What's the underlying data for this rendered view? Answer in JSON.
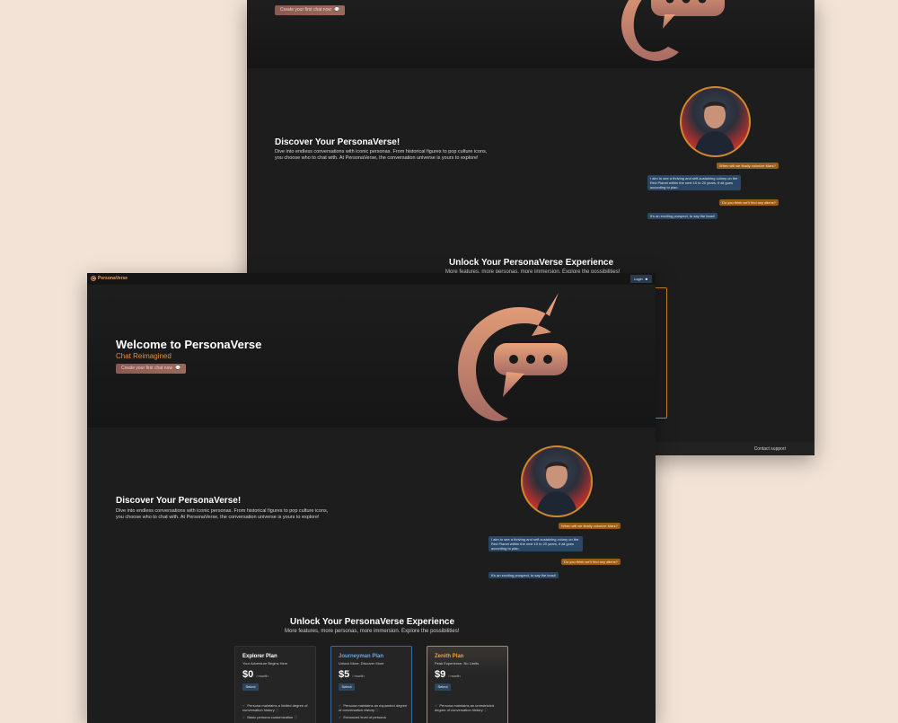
{
  "app": {
    "brand": "PersonaVerse",
    "login_label": "Login"
  },
  "hero": {
    "title": "Welcome to PersonaVerse",
    "tagline": "Chat Reimagined",
    "cta_label": "Create your first chat now"
  },
  "discover": {
    "title": "Discover Your PersonaVerse!",
    "body": "Dive into endless conversations with iconic personas. From historical figures to pop culture icons, you choose who to chat with. At PersonaVerse, the conversation universe is yours to explore!"
  },
  "chat": {
    "messages": [
      {
        "role": "user",
        "text": "When will we finally colonize Mars?"
      },
      {
        "role": "persona",
        "text": "I aim to see a thriving and self-sustaining colony on the Red Planet within the next 10 to 20 years, if all goes according to plan."
      },
      {
        "role": "user",
        "text": "Do you think we'll find any aliens?"
      },
      {
        "role": "persona",
        "text": "It's an exciting prospect, to say the least!"
      }
    ]
  },
  "plans": {
    "title": "Unlock Your PersonaVerse Experience",
    "subtitle": "More features, more personas, more immersion. Explore the possibilities!",
    "items": [
      {
        "name": "Explorer Plan",
        "tagline": "Your Adventure Begins Here",
        "price": "$0",
        "period": "/ month",
        "select_label": "Select",
        "features": [
          "Persona maintains a limited degree of conversation history",
          "Basic persona customization"
        ]
      },
      {
        "name": "Journeyman Plan",
        "tagline": "Unlock More, Discover More",
        "price": "$5",
        "period": "/ month",
        "select_label": "Select",
        "features": [
          "Persona maintains an expanded degree of conversation history",
          "Enhanced level of persona"
        ]
      },
      {
        "name": "Zenith Plan",
        "tagline": "Peak Experience, No Limits",
        "price": "$9",
        "period": "/ month",
        "select_label": "Select",
        "features": [
          "Persona maintains an unrestricted degree of conversation history"
        ]
      }
    ]
  },
  "footer": {
    "contact_label": "Contact support"
  },
  "colors": {
    "accent": "#e0913c",
    "user_bubble": "#9a5d16",
    "persona_bubble": "#2b4766",
    "background": "#f2e3d6"
  }
}
